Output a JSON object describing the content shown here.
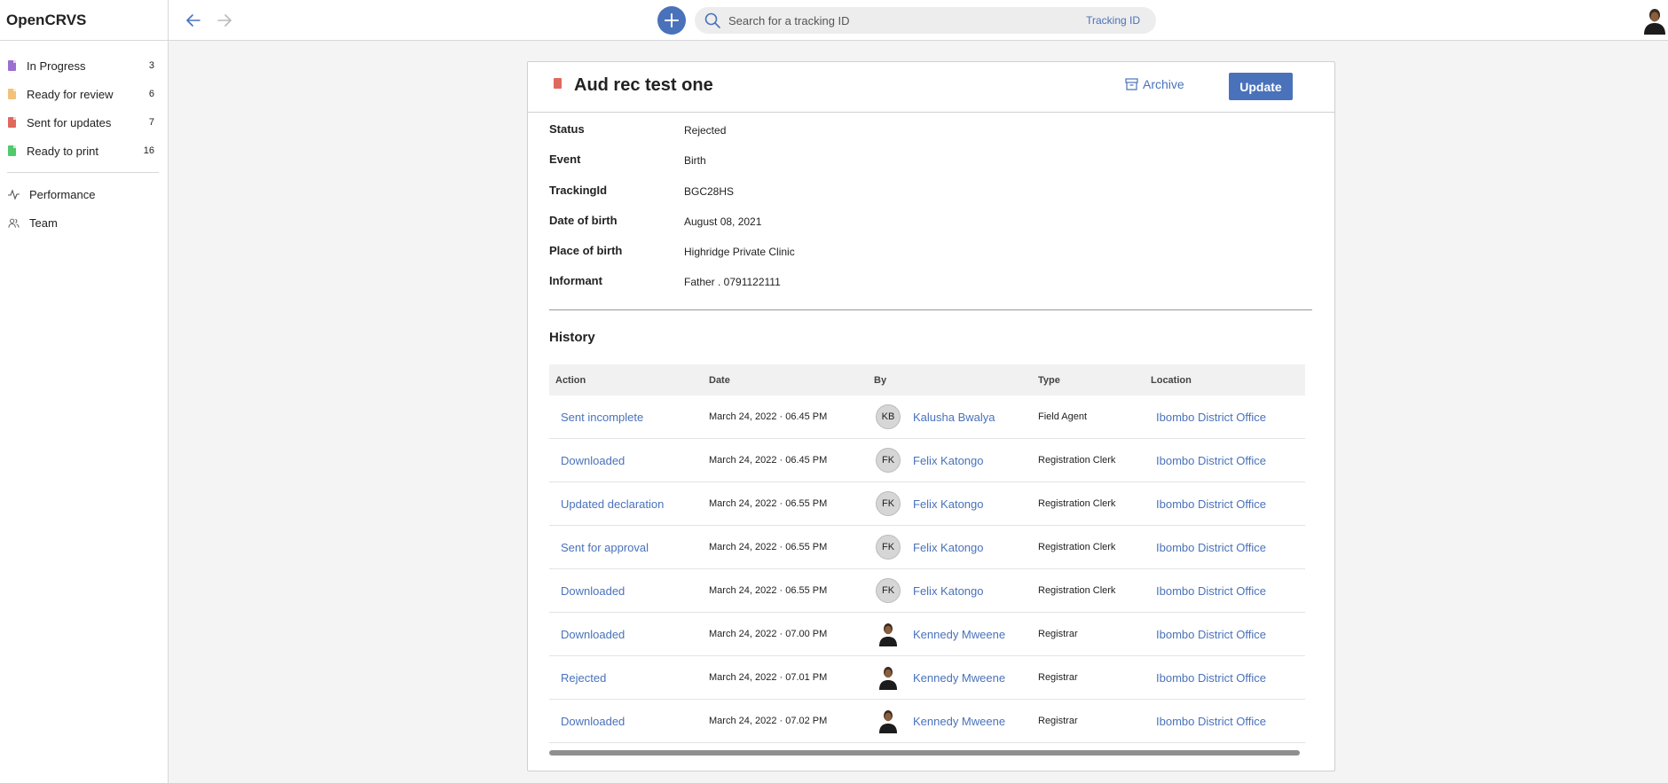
{
  "app": {
    "title": "OpenCRVS"
  },
  "sidebar": {
    "items": [
      {
        "label": "In Progress",
        "count": "3",
        "color": "#9b6fcf"
      },
      {
        "label": "Ready for review",
        "count": "6",
        "color": "#f3c27a"
      },
      {
        "label": "Sent for updates",
        "count": "7",
        "color": "#e0695f"
      },
      {
        "label": "Ready to print",
        "count": "16",
        "color": "#52c96b"
      }
    ],
    "links": [
      {
        "label": "Performance",
        "icon": "activity-icon"
      },
      {
        "label": "Team",
        "icon": "users-icon"
      }
    ]
  },
  "search": {
    "placeholder": "Search for a tracking ID",
    "type_label": "Tracking ID"
  },
  "record": {
    "title": "Aud rec test one",
    "archive_label": "Archive",
    "update_label": "Update",
    "details": [
      {
        "key": "Status",
        "value": "Rejected"
      },
      {
        "key": "Event",
        "value": "Birth"
      },
      {
        "key": "TrackingId",
        "value": "BGC28HS"
      },
      {
        "key": "Date of birth",
        "value": "August 08, 2021"
      },
      {
        "key": "Place of birth",
        "value": "Highridge Private Clinic"
      },
      {
        "key": "Informant",
        "value": "Father . 0791122111"
      }
    ]
  },
  "history": {
    "title": "History",
    "columns": [
      "Action",
      "Date",
      "By",
      "Type",
      "Location"
    ],
    "rows": [
      {
        "action": "Sent incomplete",
        "date": "March 24, 2022 · 06.45 PM",
        "initials": "KB",
        "by": "Kalusha Bwalya",
        "type": "Field Agent",
        "location": "Ibombo District Office"
      },
      {
        "action": "Downloaded",
        "date": "March 24, 2022 · 06.45 PM",
        "initials": "FK",
        "by": "Felix Katongo",
        "type": "Registration Clerk",
        "location": "Ibombo District Office"
      },
      {
        "action": "Updated declaration",
        "date": "March 24, 2022 · 06.55 PM",
        "initials": "FK",
        "by": "Felix Katongo",
        "type": "Registration Clerk",
        "location": "Ibombo District Office"
      },
      {
        "action": "Sent for approval",
        "date": "March 24, 2022 · 06.55 PM",
        "initials": "FK",
        "by": "Felix Katongo",
        "type": "Registration Clerk",
        "location": "Ibombo District Office"
      },
      {
        "action": "Downloaded",
        "date": "March 24, 2022 · 06.55 PM",
        "initials": "FK",
        "by": "Felix Katongo",
        "type": "Registration Clerk",
        "location": "Ibombo District Office"
      },
      {
        "action": "Downloaded",
        "date": "March 24, 2022 · 07.00 PM",
        "initials": "",
        "by": "Kennedy Mweene",
        "type": "Registrar",
        "location": "Ibombo District Office"
      },
      {
        "action": "Rejected",
        "date": "March 24, 2022 · 07.01 PM",
        "initials": "",
        "by": "Kennedy Mweene",
        "type": "Registrar",
        "location": "Ibombo District Office"
      },
      {
        "action": "Downloaded",
        "date": "March 24, 2022 · 07.02 PM",
        "initials": "",
        "by": "Kennedy Mweene",
        "type": "Registrar",
        "location": "Ibombo District Office"
      }
    ]
  },
  "colors": {
    "accent": "#4972bb",
    "record_icon": "#e0695f"
  }
}
